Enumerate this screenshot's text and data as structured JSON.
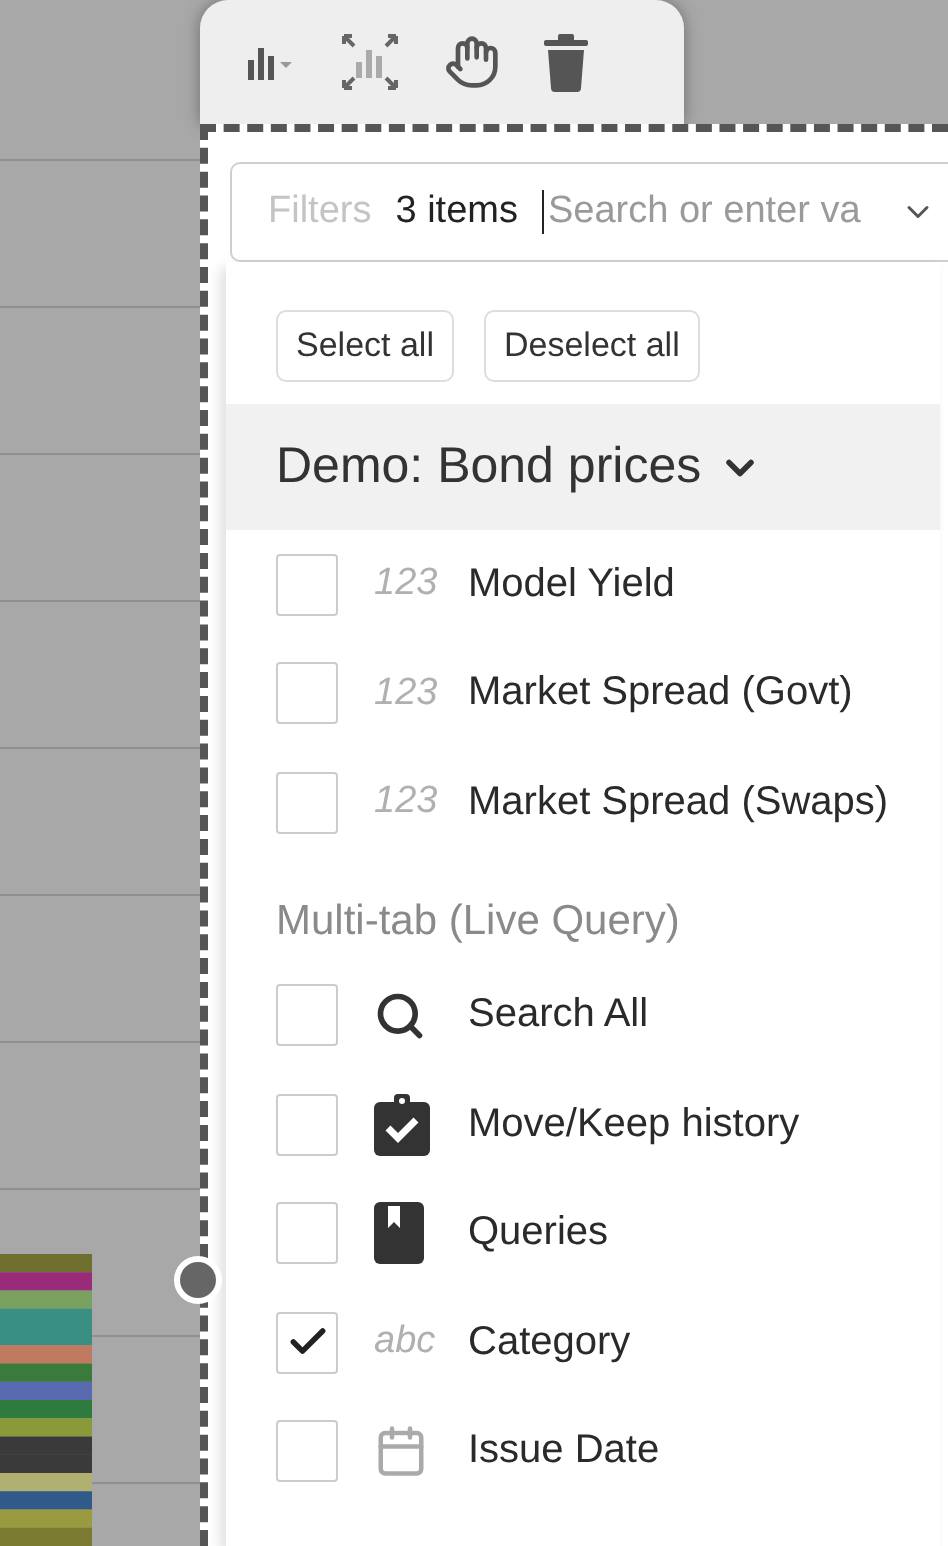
{
  "filter": {
    "label": "Filters",
    "value": "3 items",
    "placeholder": "Search or enter va"
  },
  "actions": [
    "Select all",
    "Deselect all"
  ],
  "group": {
    "title": "Demo: Bond prices",
    "expanded": true,
    "items": [
      {
        "kind": "number",
        "type": "123",
        "label": "Model Yield",
        "checked": false
      },
      {
        "kind": "number",
        "type": "123",
        "label": "Market Spread (Govt)",
        "checked": false
      },
      {
        "kind": "number",
        "type": "123",
        "label": "Market Spread (Swaps)",
        "checked": false
      }
    ]
  },
  "section": {
    "title": "Multi-tab (Live Query)",
    "items": [
      {
        "kind": "search",
        "label": "Search All",
        "checked": false
      },
      {
        "kind": "clipboard",
        "label": "Move/Keep history",
        "checked": false
      },
      {
        "kind": "bookmark",
        "label": "Queries",
        "checked": false
      },
      {
        "kind": "text",
        "type": "abc",
        "label": "Category",
        "checked": true
      },
      {
        "kind": "date",
        "label": "Issue Date",
        "checked": false
      }
    ]
  }
}
